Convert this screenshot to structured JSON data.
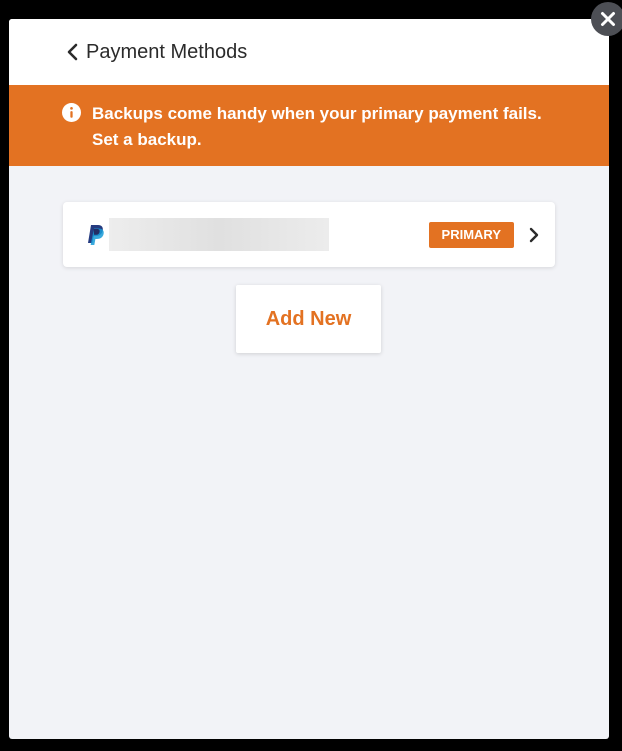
{
  "header": {
    "back_icon": "chevron-left-icon",
    "title": "Payment Methods"
  },
  "banner": {
    "icon": "info-icon",
    "line1": "Backups come handy when your primary payment fails.",
    "line2": "Set a backup.",
    "color": "#e37222"
  },
  "payment_methods": [
    {
      "provider_icon": "paypal-icon",
      "badge": "PRIMARY",
      "chevron": "chevron-right-icon"
    }
  ],
  "add_button": {
    "label": "Add New"
  },
  "close_icon": "close-icon",
  "colors": {
    "accent": "#e37222",
    "paypal_blue": "#253b80",
    "paypal_light": "#179bd7",
    "modal_bg": "#f2f3f7"
  }
}
